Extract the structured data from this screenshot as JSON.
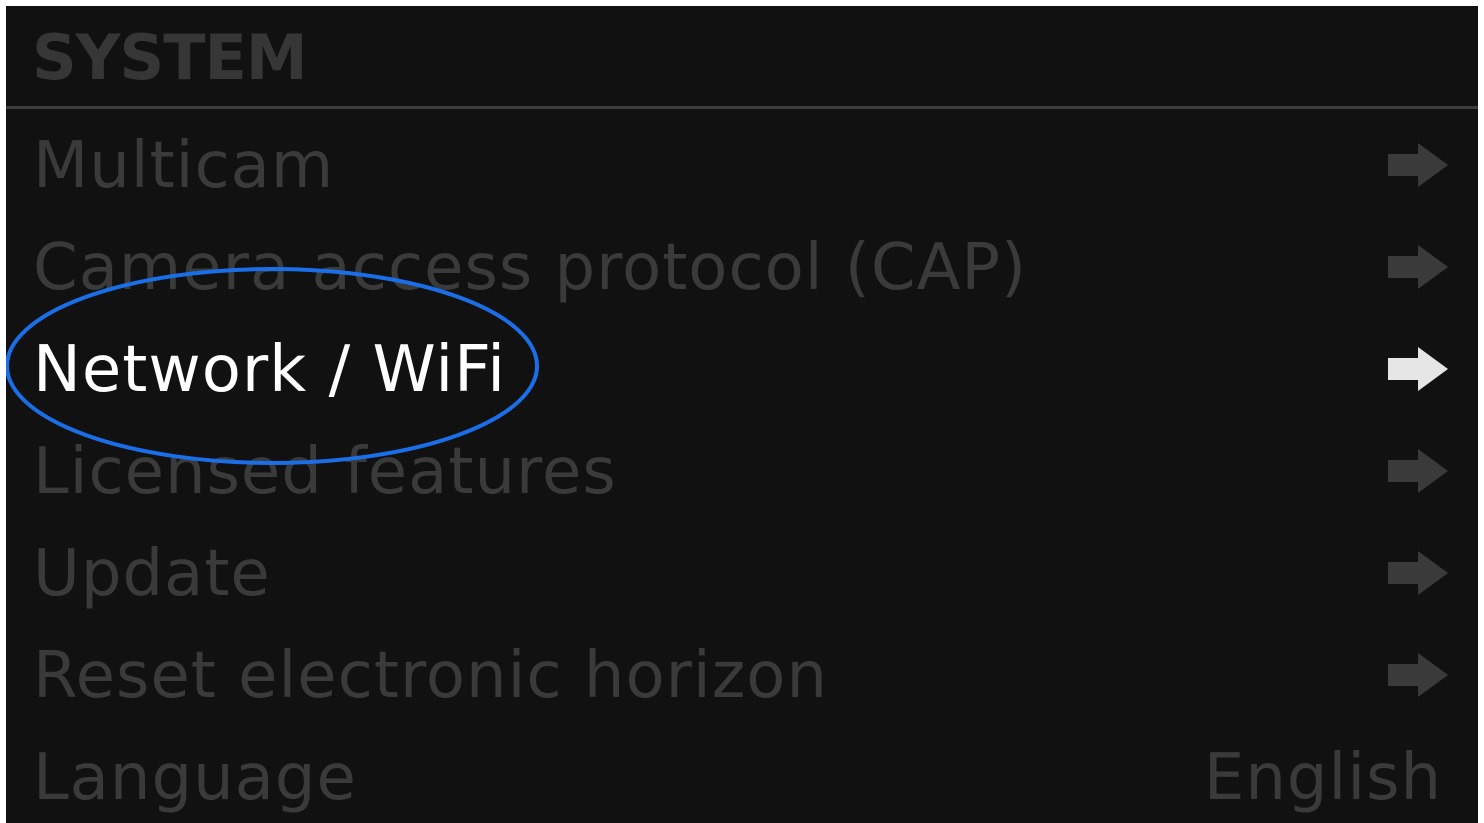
{
  "header": {
    "title": "SYSTEM"
  },
  "menu": {
    "items": [
      {
        "label": "Multicam",
        "action": "arrow",
        "active": false
      },
      {
        "label": "Camera access protocol (CAP)",
        "action": "arrow",
        "active": false
      },
      {
        "label": "Network / WiFi",
        "action": "arrow",
        "active": true
      },
      {
        "label": "Licensed features",
        "action": "arrow",
        "active": false
      },
      {
        "label": "Update",
        "action": "arrow",
        "active": false
      },
      {
        "label": "Reset electronic horizon",
        "action": "arrow",
        "active": false
      },
      {
        "label": "Language",
        "value": "English",
        "active": false
      }
    ]
  },
  "colors": {
    "background": "#111111",
    "inactive_text": "#3a3a3a",
    "active_text": "#ffffff",
    "inactive_arrow": "#3a3a3a",
    "active_arrow": "#e6e6e6",
    "annotation_ellipse": "#1a6fe8"
  },
  "icons": {
    "arrow": "arrow-right-icon"
  }
}
